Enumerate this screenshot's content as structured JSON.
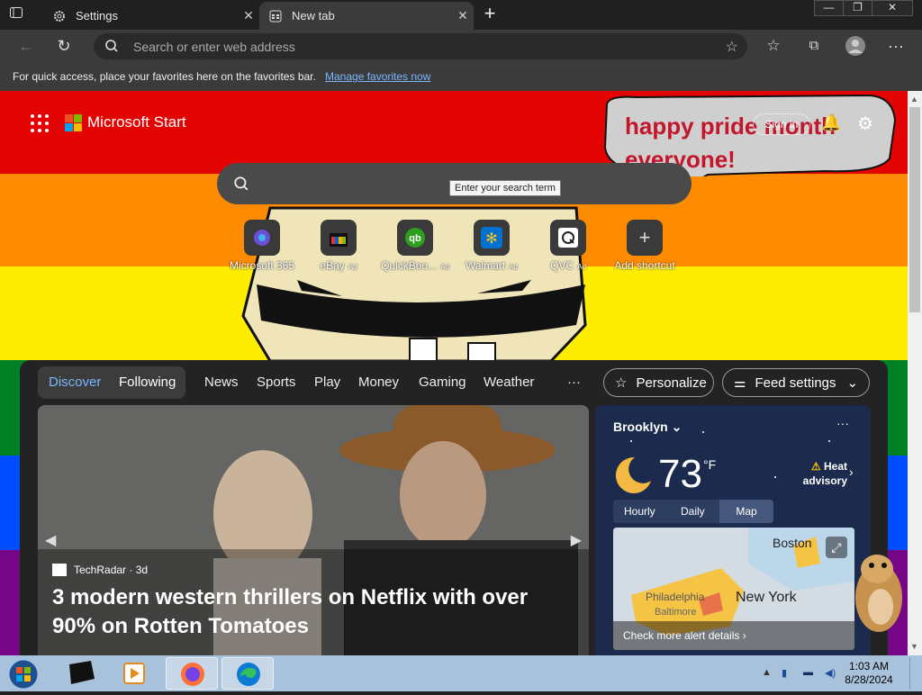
{
  "browser": {
    "tabs": [
      {
        "label": "Settings",
        "active": false
      },
      {
        "label": "New tab",
        "active": true
      }
    ],
    "address_placeholder": "Search or enter web address",
    "favorites_bar": {
      "message": "For quick access, place your favorites here on the favorites bar.",
      "link": "Manage favorites now"
    }
  },
  "start": {
    "brand": "Microsoft Start",
    "bubble_text": "happy pride month everyone!",
    "signin": "Sign in",
    "search_tooltip": "Enter your search term",
    "shortcuts": [
      {
        "name": "Microsoft 365",
        "ad": ""
      },
      {
        "name": "eBay",
        "ad": "Ad"
      },
      {
        "name": "QuickBoo...",
        "ad": "Ad"
      },
      {
        "name": "Walmart",
        "ad": "Ad"
      },
      {
        "name": "QVC",
        "ad": "Ad"
      },
      {
        "name": "Add shortcut",
        "ad": ""
      }
    ]
  },
  "feed": {
    "segments": [
      "Discover",
      "Following"
    ],
    "nav": [
      "News",
      "Sports",
      "Play",
      "Money",
      "Gaming",
      "Weather"
    ],
    "more": "···",
    "personalize": "Personalize",
    "feed_settings": "Feed settings",
    "hero": {
      "source": "TechRadar · 3d",
      "headline": "3 modern western thrillers on Netflix with over 90% on Rotten Tomatoes"
    },
    "weather": {
      "city": "Brooklyn",
      "temp": "73",
      "unit": "°F",
      "advisory_line1": "Heat",
      "advisory_line2": "advisory",
      "tabs": [
        "Hourly",
        "Daily",
        "Map"
      ],
      "active_tab": "Map",
      "map_labels": [
        "Boston",
        "New York",
        "Philadelphia",
        "Baltimore"
      ],
      "alert_link": "Check more alert details"
    }
  },
  "taskbar": {
    "time": "1:03 AM",
    "date": "8/28/2024"
  },
  "colors": {
    "pride": [
      "#e40303",
      "#ff8c00",
      "#ffed00",
      "#008026",
      "#004dff",
      "#750787"
    ],
    "link": "#7ab7ff",
    "bubble_text": "#c3162a"
  }
}
